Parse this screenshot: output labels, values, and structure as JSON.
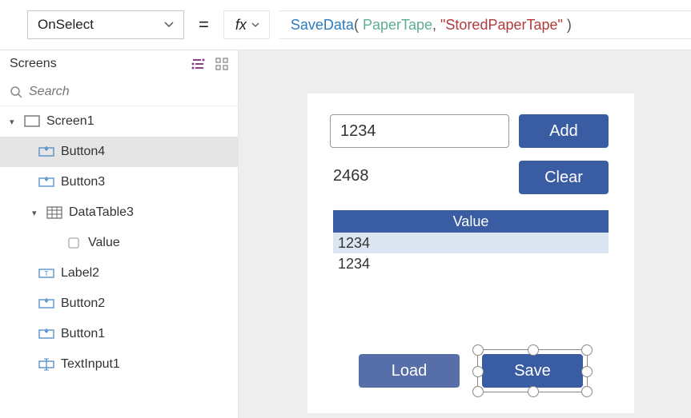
{
  "formula_bar": {
    "property": "OnSelect",
    "fx_label": "fx",
    "function_name": "SaveData",
    "arg_identifier": "PaperTape",
    "arg_string": "\"StoredPaperTape\""
  },
  "tree_panel": {
    "title": "Screens",
    "search_placeholder": "Search",
    "items": [
      {
        "label": "Screen1",
        "type": "screen"
      },
      {
        "label": "Button4",
        "type": "button",
        "selected": true
      },
      {
        "label": "Button3",
        "type": "button"
      },
      {
        "label": "DataTable3",
        "type": "datatable"
      },
      {
        "label": "Value",
        "type": "column"
      },
      {
        "label": "Label2",
        "type": "label"
      },
      {
        "label": "Button2",
        "type": "button"
      },
      {
        "label": "Button1",
        "type": "button"
      },
      {
        "label": "TextInput1",
        "type": "textinput"
      }
    ]
  },
  "canvas": {
    "input_value": "1234",
    "result_label": "2468",
    "add_button": "Add",
    "clear_button": "Clear",
    "load_button": "Load",
    "save_button": "Save",
    "table_header": "Value",
    "table_rows": [
      "1234",
      "1234"
    ]
  }
}
